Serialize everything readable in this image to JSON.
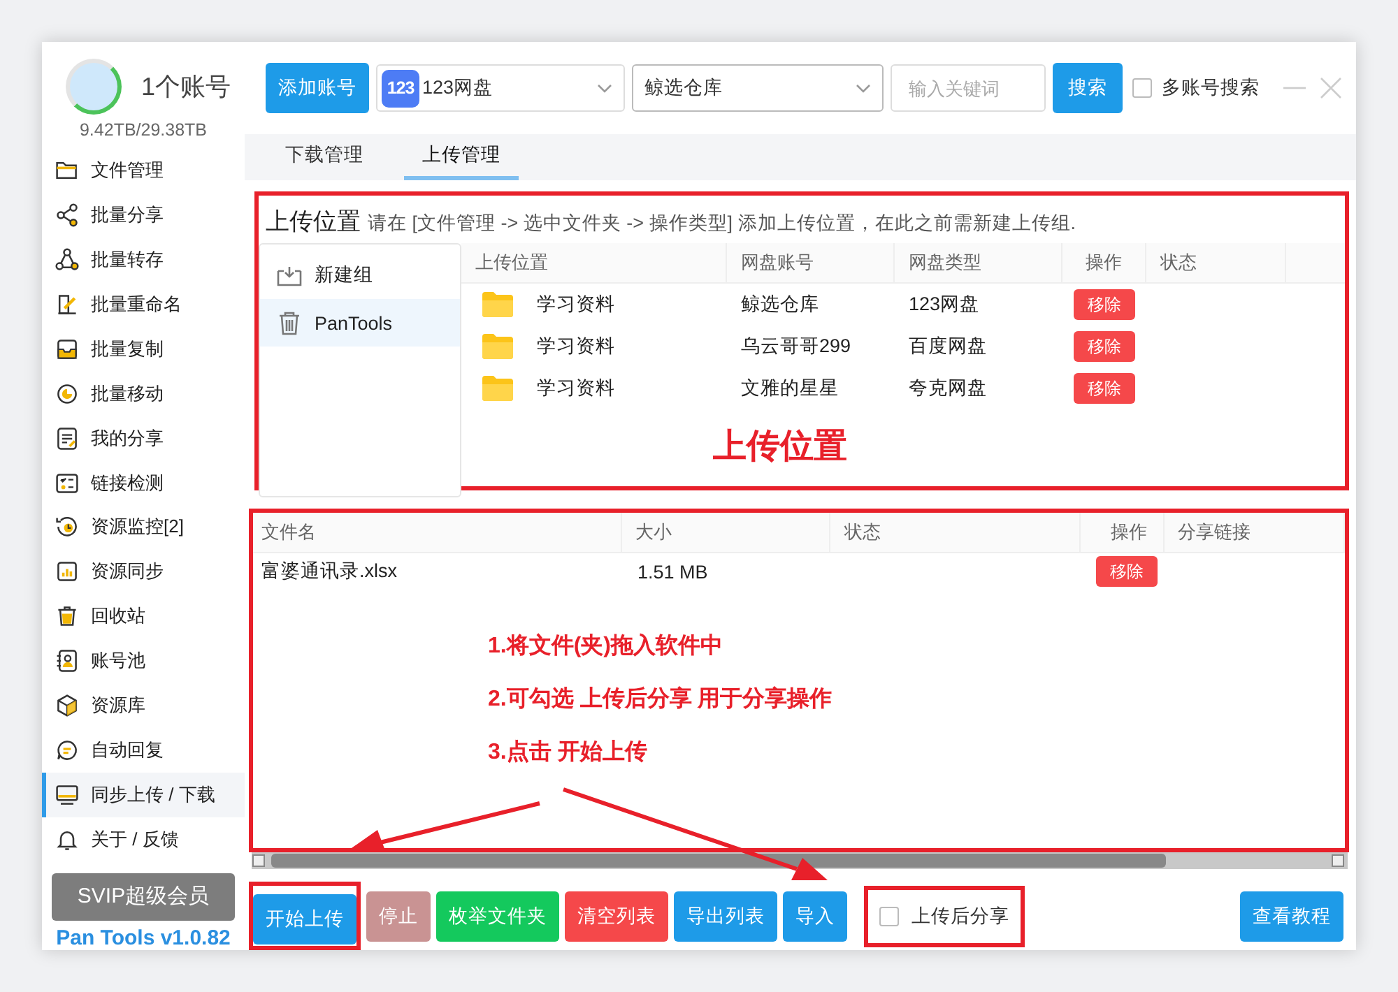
{
  "account": {
    "title": "1个账号",
    "storage": "9.42TB/29.38TB"
  },
  "sidebar": {
    "items": [
      {
        "label": "文件管理",
        "selected": false
      },
      {
        "label": "批量分享",
        "selected": false
      },
      {
        "label": "批量转存",
        "selected": false
      },
      {
        "label": "批量重命名",
        "selected": false
      },
      {
        "label": "批量复制",
        "selected": false
      },
      {
        "label": "批量移动",
        "selected": false
      },
      {
        "label": "我的分享",
        "selected": false
      },
      {
        "label": "链接检测",
        "selected": false
      },
      {
        "label": "资源监控[2]",
        "selected": false
      },
      {
        "label": "资源同步",
        "selected": false
      },
      {
        "label": "回收站",
        "selected": false
      },
      {
        "label": "账号池",
        "selected": false
      },
      {
        "label": "资源库",
        "selected": false
      },
      {
        "label": "自动回复",
        "selected": false
      },
      {
        "label": "同步上传 / 下载",
        "selected": true
      },
      {
        "label": "关于 / 反馈",
        "selected": false
      }
    ],
    "vip_button": "SVIP超级会员",
    "version": "Pan Tools v1.0.82"
  },
  "toolbar": {
    "add_account": "添加账号",
    "provider_logo": "123",
    "provider_select": "123网盘",
    "account_select": "鲸选仓库",
    "search": {
      "placeholder": "输入关键词"
    },
    "search_button": "搜索",
    "multi_account": {
      "label": "多账号搜索",
      "checked": false
    }
  },
  "tabs": [
    {
      "label": "下载管理",
      "selected": false
    },
    {
      "label": "上传管理",
      "selected": true
    }
  ],
  "upload_location": {
    "title": "上传位置",
    "hint": "请在 [文件管理 -> 选中文件夹 -> 操作类型] 添加上传位置，在此之前需新建上传组.",
    "groups": [
      {
        "label": "新建组",
        "kind": "new",
        "selected": false
      },
      {
        "label": "PanTools",
        "kind": "group",
        "selected": true
      }
    ],
    "columns": [
      "上传位置",
      "网盘账号",
      "网盘类型",
      "操作",
      "状态"
    ],
    "rows": [
      {
        "folder": "学习资料",
        "account": "鲸选仓库",
        "type": "123网盘",
        "action": "移除"
      },
      {
        "folder": "学习资料",
        "account": "乌云哥哥299",
        "type": "百度网盘",
        "action": "移除"
      },
      {
        "folder": "学习资料",
        "account": "文雅的星星",
        "type": "夸克网盘",
        "action": "移除"
      }
    ]
  },
  "file_table": {
    "columns": [
      "文件名",
      "大小",
      "状态",
      "操作",
      "分享链接"
    ],
    "rows": [
      {
        "name": "富婆通讯录.xlsx",
        "size": "1.51 MB",
        "action": "移除"
      }
    ]
  },
  "bottom_buttons": [
    {
      "label": "开始上传",
      "kind": "primary"
    },
    {
      "label": "停止",
      "kind": "disabled"
    },
    {
      "label": "枚举文件夹",
      "kind": "success"
    },
    {
      "label": "清空列表",
      "kind": "danger"
    },
    {
      "label": "导出列表",
      "kind": "primary"
    },
    {
      "label": "导入",
      "kind": "primary"
    }
  ],
  "share_after_upload": {
    "label": "上传后分享",
    "checked": false
  },
  "tutorial_button": "查看教程",
  "annotations": {
    "panel_label": "上传位置",
    "steps": [
      "1.将文件(夹)拖入软件中",
      "2.可勾选 上传后分享 用于分享操作",
      "3.点击 开始上传"
    ]
  }
}
